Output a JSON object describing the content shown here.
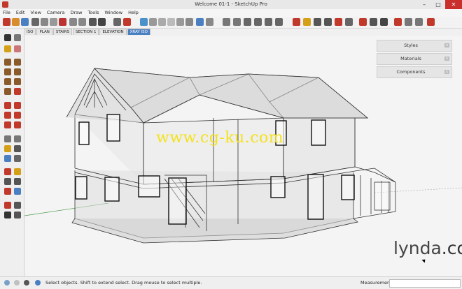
{
  "window": {
    "title": "Welcome 01-1 - SketchUp Pro",
    "minimize": "–",
    "maximize": "□",
    "close": "✕"
  },
  "menu": [
    "File",
    "Edit",
    "View",
    "Camera",
    "Draw",
    "Tools",
    "Window",
    "Help"
  ],
  "scenes": [
    {
      "label": "ISO",
      "active": false
    },
    {
      "label": "PLAN",
      "active": false
    },
    {
      "label": "STAIRS",
      "active": false
    },
    {
      "label": "SECTION 1",
      "active": false
    },
    {
      "label": "ELEVATION",
      "active": false
    },
    {
      "label": "XRAY ISO",
      "active": true
    }
  ],
  "tray": [
    {
      "label": "Styles",
      "close": "x"
    },
    {
      "label": "Materials",
      "close": "x"
    },
    {
      "label": "Components",
      "close": "x"
    }
  ],
  "overlay": {
    "watermark": "www.cg-ku.com",
    "brand": "lynda",
    "brand_suffix": ".com"
  },
  "status": {
    "hint": "Select objects. Shift to extend select. Drag mouse to select multiple.",
    "measurements_label": "Measurements",
    "measurements_value": ""
  },
  "colors": {
    "accent": "#4a7fc1",
    "close": "#c9302c",
    "watermark": "#f4e21c"
  }
}
